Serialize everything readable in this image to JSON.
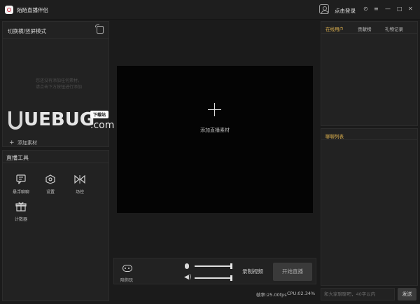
{
  "app": {
    "title": "陌陌直播伴侣",
    "logo_icon": "momo-logo-icon"
  },
  "header": {
    "avatar_icon": "user-avatar-icon",
    "login_label": "点击登录",
    "controls": {
      "settings": "⊙",
      "menu": "≡",
      "minimize": "—",
      "maximize": "□",
      "close": "✕"
    }
  },
  "left_panel": {
    "title": "切换横/竖屏模式",
    "empty_hint": [
      "您还没有添加任何素材，",
      "请点击下方按钮进行添加"
    ],
    "add_material_label": "添加素材",
    "watermark": {
      "text": "UEBUG",
      "domain": ".com",
      "badge": "下载站"
    }
  },
  "tools": {
    "title": "直播工具",
    "items": [
      {
        "label": "悬浮聊聊",
        "icon": "chat-float-icon"
      },
      {
        "label": "设置",
        "icon": "settings-icon"
      },
      {
        "label": "场控",
        "icon": "field-control-icon"
      },
      {
        "label": "计数器",
        "icon": "counter-gift-icon"
      }
    ]
  },
  "preview": {
    "add_label": "添加直播素材"
  },
  "controls": {
    "game_label": "陪你玩",
    "mic_level": 1.0,
    "speaker_level": 1.0,
    "record_label": "录制视频",
    "start_label": "开始直播"
  },
  "status": {
    "fps": "帧率:25.00fps",
    "cpu": "CPU:02.34%"
  },
  "right_panel": {
    "tabs": [
      {
        "label": "在线用户",
        "active": true
      },
      {
        "label": "贡献榜",
        "active": false
      },
      {
        "label": "礼物记录",
        "active": false
      }
    ],
    "chat_title": "聊聊列表",
    "chat_placeholder": "和大家聊聊吧，40字以内",
    "send_label": "发送"
  },
  "colors": {
    "accent": "#e0b34f",
    "background": "#1b1b1b",
    "panel": "#222222"
  }
}
